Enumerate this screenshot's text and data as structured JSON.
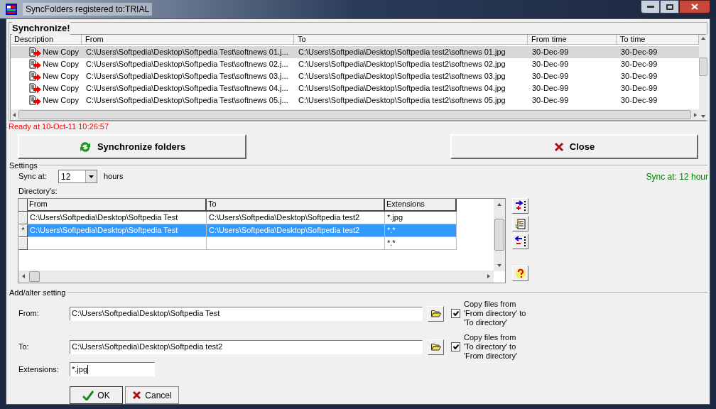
{
  "window": {
    "title": "SyncFolders registered to:TRIAL"
  },
  "synchronize": {
    "title": "Synchronize!",
    "columns": [
      "Description",
      "From",
      "To",
      "From time",
      "To time"
    ],
    "rows": [
      {
        "description": "New Copy",
        "from": "C:\\Users\\Softpedia\\Desktop\\Softpedia Test\\softnews 01.j...",
        "to": "C:\\Users\\Softpedia\\Desktop\\Softpedia test2\\softnews 01.jpg",
        "from_time": "30-Dec-99",
        "to_time": "30-Dec-99",
        "selected": true
      },
      {
        "description": "New Copy",
        "from": "C:\\Users\\Softpedia\\Desktop\\Softpedia Test\\softnews 02.j...",
        "to": "C:\\Users\\Softpedia\\Desktop\\Softpedia test2\\softnews 02.jpg",
        "from_time": "30-Dec-99",
        "to_time": "30-Dec-99",
        "selected": false
      },
      {
        "description": "New Copy",
        "from": "C:\\Users\\Softpedia\\Desktop\\Softpedia Test\\softnews 03.j...",
        "to": "C:\\Users\\Softpedia\\Desktop\\Softpedia test2\\softnews 03.jpg",
        "from_time": "30-Dec-99",
        "to_time": "30-Dec-99",
        "selected": false
      },
      {
        "description": "New Copy",
        "from": "C:\\Users\\Softpedia\\Desktop\\Softpedia Test\\softnews 04.j...",
        "to": "C:\\Users\\Softpedia\\Desktop\\Softpedia test2\\softnews 04.jpg",
        "from_time": "30-Dec-99",
        "to_time": "30-Dec-99",
        "selected": false
      },
      {
        "description": "New Copy",
        "from": "C:\\Users\\Softpedia\\Desktop\\Softpedia Test\\softnews 05.j...",
        "to": "C:\\Users\\Softpedia\\Desktop\\Softpedia test2\\softnews 05.jpg",
        "from_time": "30-Dec-99",
        "to_time": "30-Dec-99",
        "selected": false
      }
    ],
    "status": "Ready at 10-Oct-11 10:26:57"
  },
  "buttons": {
    "synchronize": "Synchronize folders",
    "close": "Close"
  },
  "settings": {
    "title": "Settings",
    "sync_label": "Sync at:",
    "sync_value": "12",
    "sync_unit": "hours",
    "sync_info": "Sync at: 12 hour",
    "directories_label": "Directory's:",
    "columns": [
      "From",
      "To",
      "Extensions"
    ],
    "rows": [
      {
        "marker": "",
        "from": "C:\\Users\\Softpedia\\Desktop\\Softpedia Test",
        "to": "C:\\Users\\Softpedia\\Desktop\\Softpedia test2",
        "extensions": "*.jpg",
        "selected": false
      },
      {
        "marker": "*",
        "from": "C:\\Users\\Softpedia\\Desktop\\Softpedia Test",
        "to": "C:\\Users\\Softpedia\\Desktop\\Softpedia test2",
        "extensions": "*.*",
        "selected": true
      },
      {
        "marker": "",
        "from": "",
        "to": "",
        "extensions": "*.*",
        "selected": false
      }
    ]
  },
  "add_alter": {
    "title": "Add/alter setting",
    "from_label": "From:",
    "from_value": "C:\\Users\\Softpedia\\Desktop\\Softpedia Test",
    "from_checkbox": {
      "label": "Copy files from 'From directory' to 'To directory'",
      "checked": true
    },
    "to_label": "To:",
    "to_value": "C:\\Users\\Softpedia\\Desktop\\Softpedia test2",
    "to_checkbox": {
      "label": "Copy files from 'To directory' to 'From directory'",
      "checked": true
    },
    "extensions_label": "Extensions:",
    "extensions_value": "*.jpg",
    "ok": "OK",
    "cancel": "Cancel"
  }
}
